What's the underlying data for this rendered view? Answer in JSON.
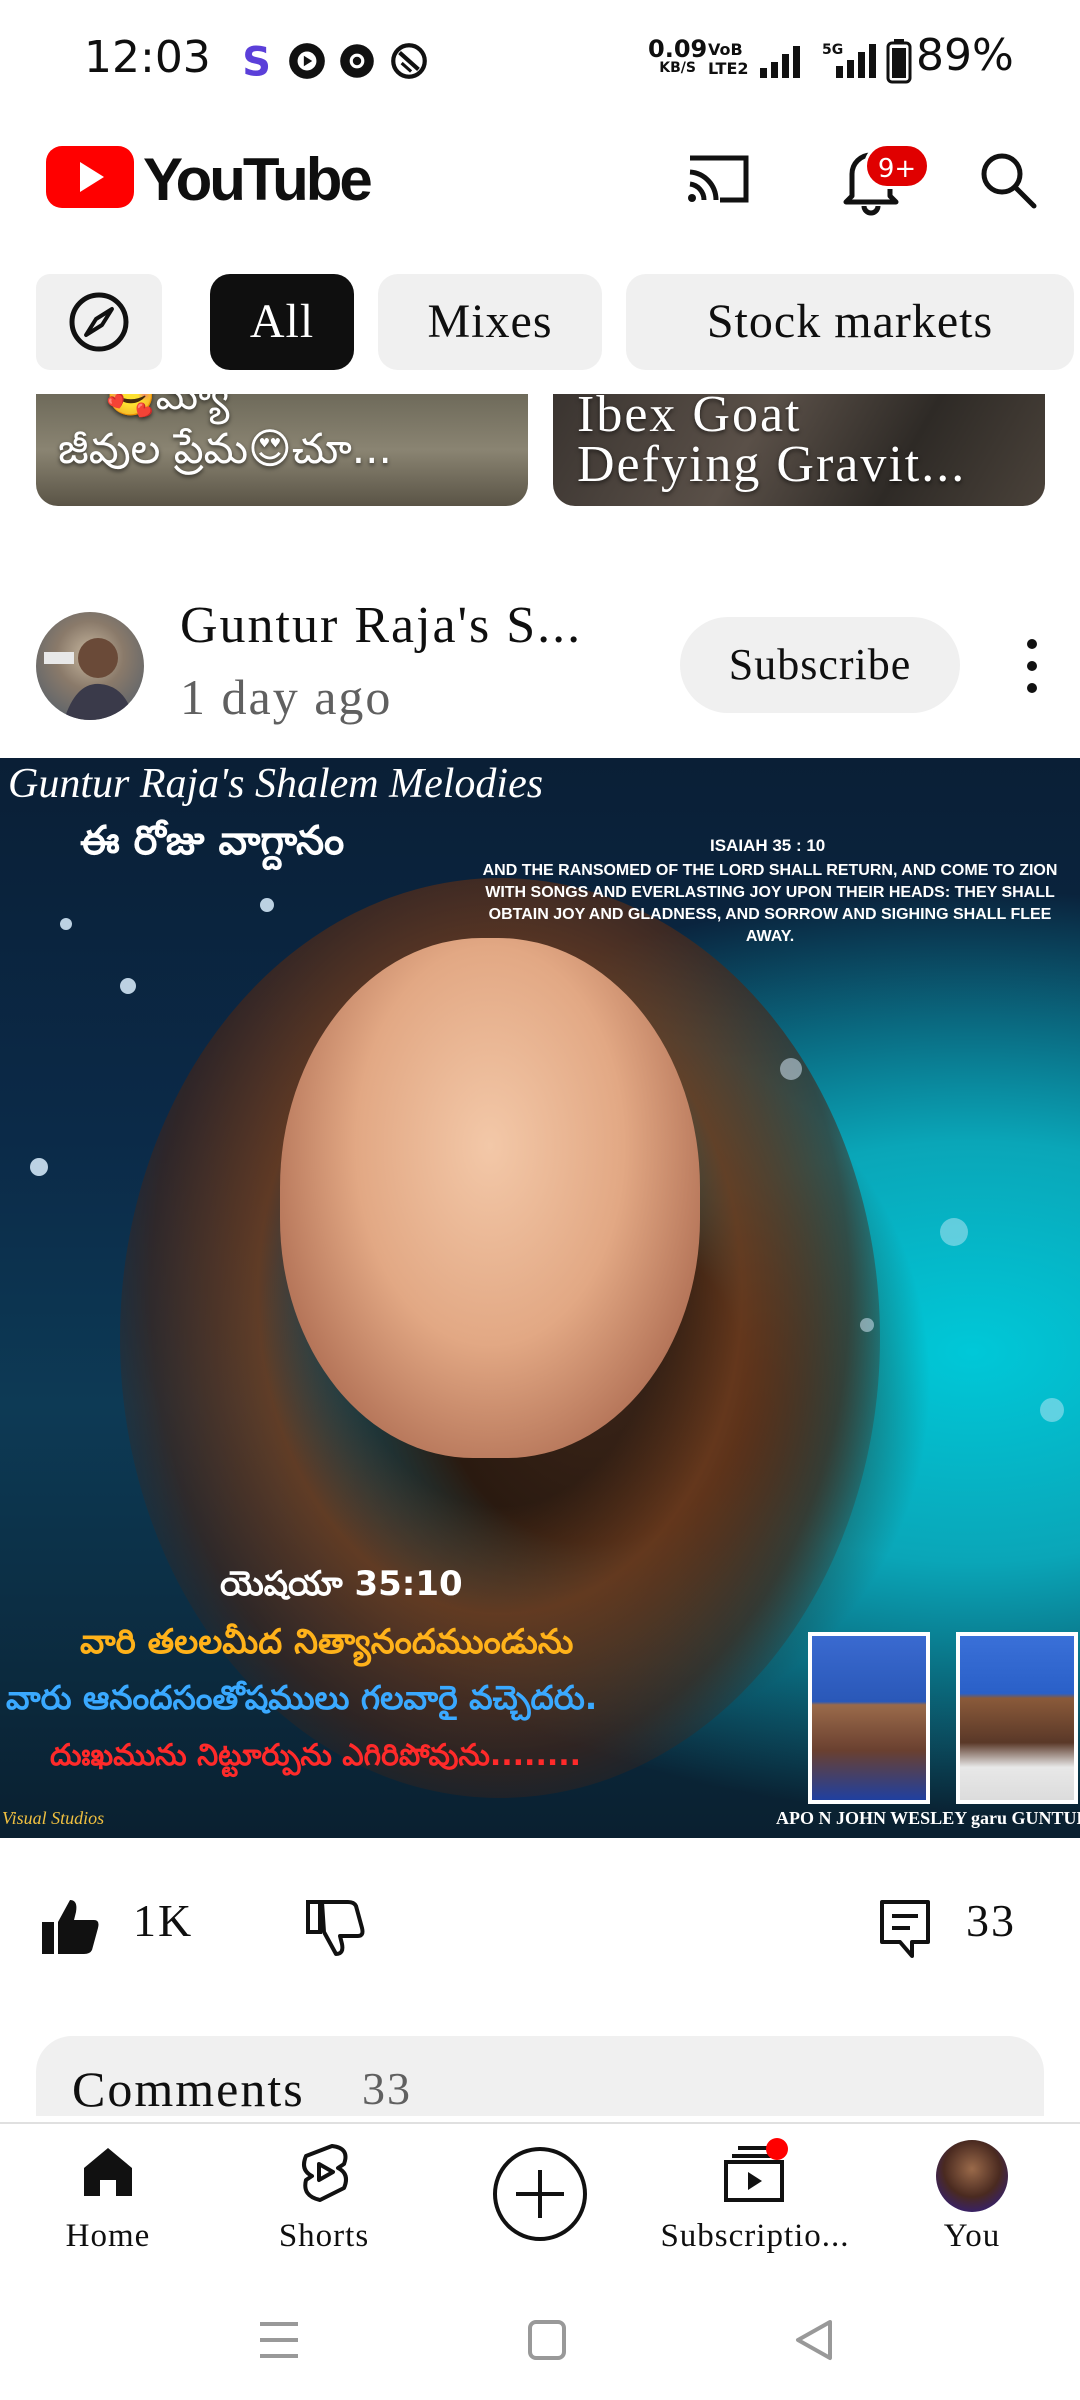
{
  "status_bar": {
    "time": "12:03",
    "net_speed_value": "0.09",
    "net_speed_unit": "KB/S",
    "volte_label_1": "VoB",
    "volte_label_2": "LTE2",
    "network_5g": "5G",
    "battery_percent": "89%"
  },
  "app_bar": {
    "logo_text": "YouTube",
    "notification_badge": "9+"
  },
  "chips": {
    "explore_icon": "compass-icon",
    "items": [
      "All",
      "Mixes",
      "Stock markets"
    ],
    "selected": "All"
  },
  "shorts": [
    {
      "title_top": "🥰మ్యో",
      "title": "జీవుల ప్రేమ😍చూ..."
    },
    {
      "title_line1": "Ibex Goat",
      "title_line2": "Defying Gravit..."
    }
  ],
  "post": {
    "channel_name": "Guntur Raja's S...",
    "time_ago": "1 day ago",
    "subscribe_label": "Subscribe",
    "image": {
      "header": "Guntur Raja's Shalem Melodies",
      "telugu_top": "ఈ రోజు వాగ్దానం",
      "verse_ref": "ISAIAH 35 : 10",
      "verse_text": "AND THE RANSOMED OF THE LORD SHALL RETURN, AND COME TO ZION WITH SONGS AND EVERLASTING JOY UPON THEIR HEADS: THEY SHALL OBTAIN JOY AND GLADNESS, AND SORROW AND SIGHING SHALL FLEE AWAY.",
      "telugu_ref": "యెషయా 35:10",
      "line_1": "వారి తలలమీద నిత్యానందముండును",
      "line_2": "వారు ఆనందసంతోషములు గలవారై వచ్చెదరు.",
      "line_3": "దుఃఖమును నిట్టూర్పును ఎగిరిపోవును........",
      "credit": "APO N JOHN WESLEY garu GUNTUR RAJA garu",
      "studio": "Visual Studios"
    },
    "like_count": "1K",
    "comment_count": "33"
  },
  "comments": {
    "label": "Comments",
    "count": "33"
  },
  "bottom_nav": {
    "items": [
      {
        "label": "Home",
        "icon": "home-icon"
      },
      {
        "label": "Shorts",
        "icon": "shorts-icon"
      },
      {
        "label": "",
        "icon": "create-icon"
      },
      {
        "label": "Subscriptio...",
        "icon": "subscriptions-icon"
      },
      {
        "label": "You",
        "icon": "avatar"
      }
    ]
  },
  "colors": {
    "brand_red": "#ff0000",
    "chip_selected_bg": "#0f0f0f",
    "chip_bg": "#f0f0f0",
    "secondary_text": "#606060"
  }
}
